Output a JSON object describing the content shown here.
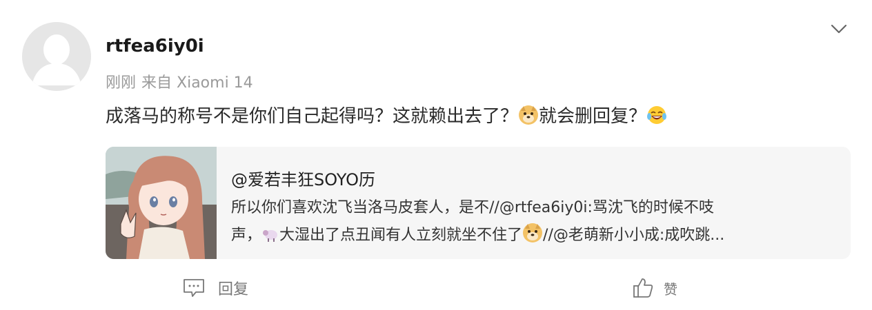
{
  "comment": {
    "username": "rtfea6iy0i",
    "time": "刚刚",
    "source": "来自 Xiaomi 14",
    "text_part1": "成落马的称号不是你们自己起得吗？这就赖出去了？",
    "text_part2": "就会删回复？",
    "avatar_icon": "default-user-avatar"
  },
  "quote": {
    "author": "@爱若丰狂SOYO历",
    "line1": "所以你们喜欢沈飞当洛马皮套人，是不//@rtfea6iy0i:骂沈飞的时候不吱",
    "line2_part1": "声，",
    "line2_part2": "大湿出了点丑闻有人立刻就坐不住了",
    "line2_part3": "//@老萌新小小成:成吹跳...",
    "thumbnail_icon": "anime-girl-thumbnail"
  },
  "actions": {
    "reply_label": "回复",
    "like_label": "赞"
  },
  "colors": {
    "text_primary": "#222222",
    "text_meta": "#9a9a9a",
    "card_bg": "#f6f6f6",
    "action_gray": "#777777"
  }
}
